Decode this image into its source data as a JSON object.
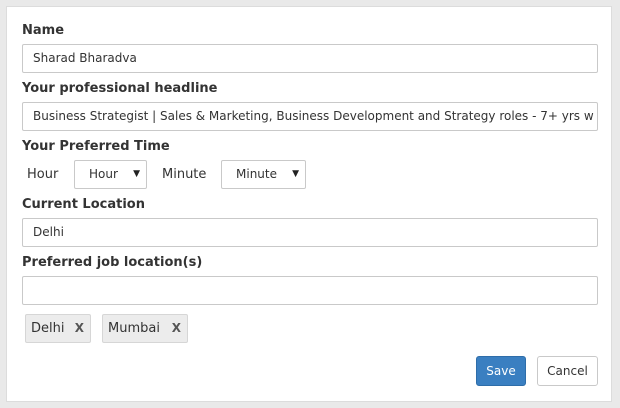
{
  "form": {
    "name_label": "Name",
    "name_value": "Sharad Bharadva",
    "headline_label": "Your professional headline",
    "headline_value": "Business Strategist | Sales & Marketing, Business Development and Strategy roles - 7+ yrs w",
    "time_label": "Your Preferred Time",
    "hour_label": "Hour",
    "hour_select": "Hour",
    "minute_label": "Minute",
    "minute_select": "Minute",
    "location_label": "Current Location",
    "location_value": "Delhi",
    "preferred_label": "Preferred job location(s)",
    "preferred_value": "",
    "tags": [
      "Delhi",
      "Mumbai"
    ],
    "tag_remove": "X",
    "caret": "▼"
  },
  "buttons": {
    "save": "Save",
    "cancel": "Cancel"
  },
  "colors": {
    "primary": "#3a7fc1",
    "background": "#e9e9e9"
  }
}
